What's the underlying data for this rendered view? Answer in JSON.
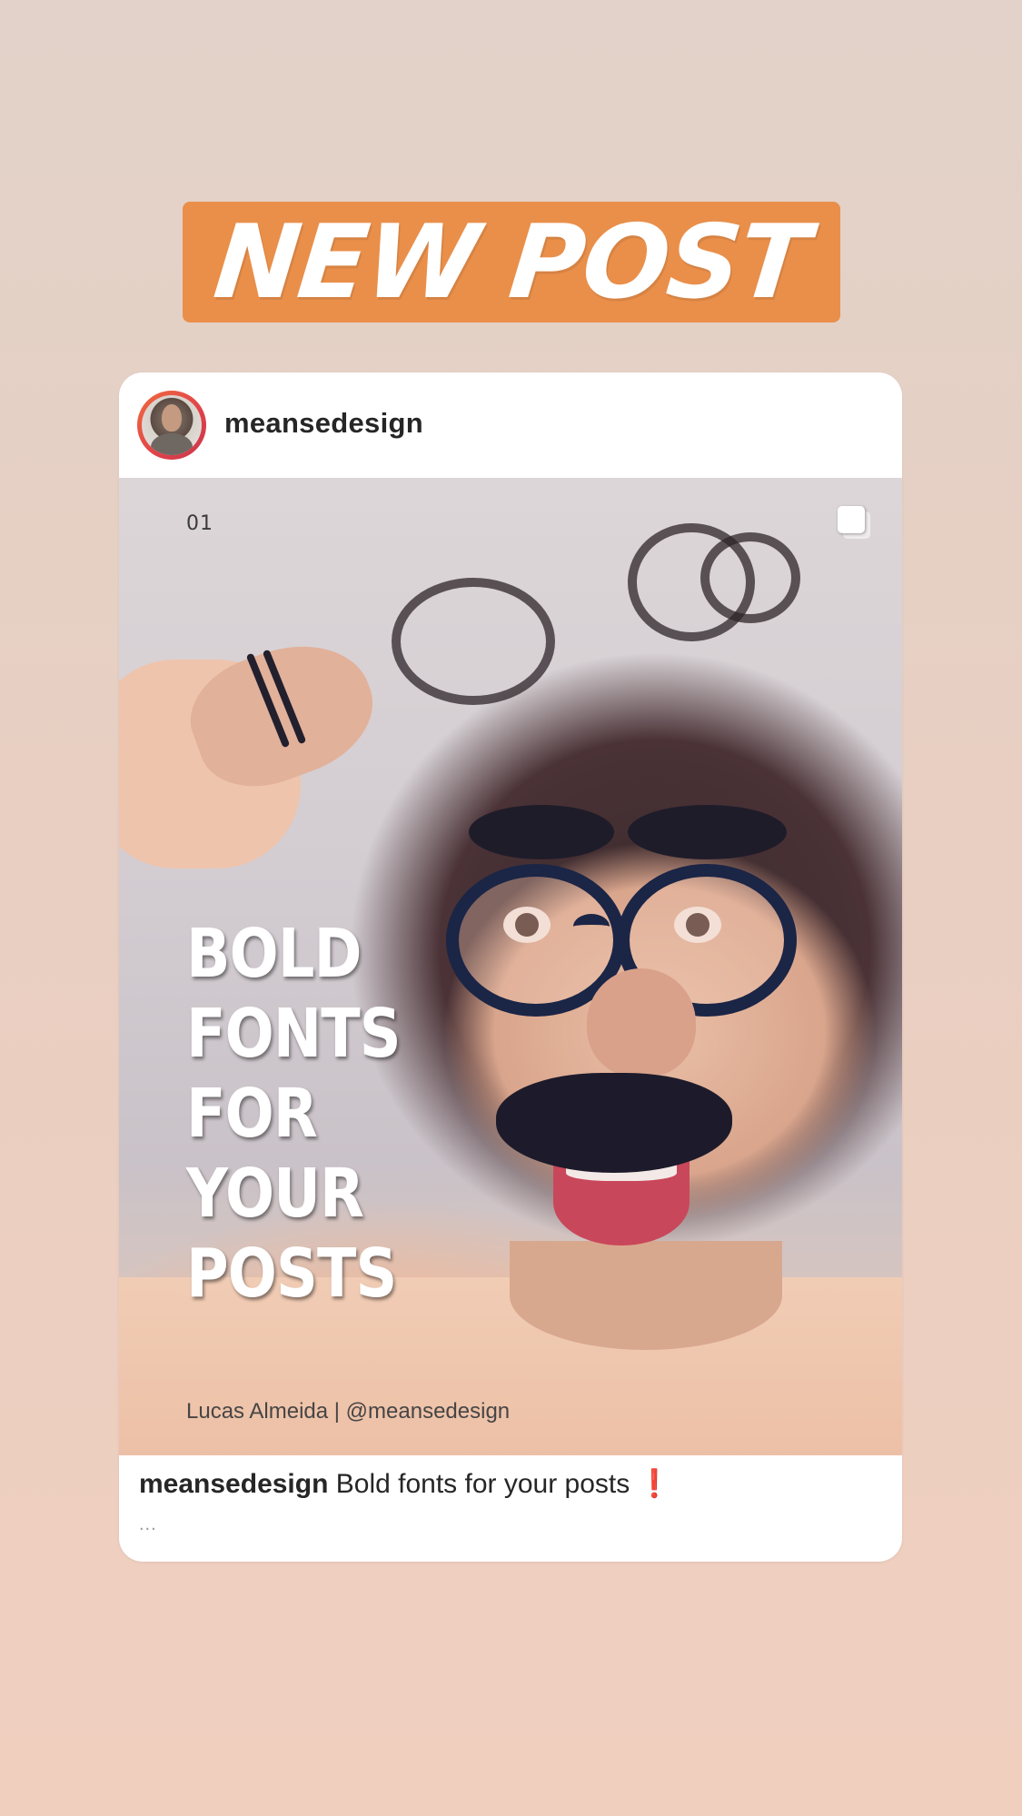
{
  "sticker": {
    "text": "NEW POST",
    "color": "#e98f4a"
  },
  "post": {
    "username": "meansedesign",
    "avatar_icon": "profile-avatar",
    "slide_number": "01",
    "multi_image_icon": "carousel-icon",
    "image": {
      "headline_lines": [
        "BOLD",
        "FONTS",
        "FOR",
        "YOUR",
        "POSTS"
      ],
      "credit": "Lucas Almeida | @meansedesign"
    },
    "caption": {
      "username": "meansedesign",
      "text": " Bold fonts for your posts ",
      "emoji": "❗",
      "more": "..."
    }
  }
}
